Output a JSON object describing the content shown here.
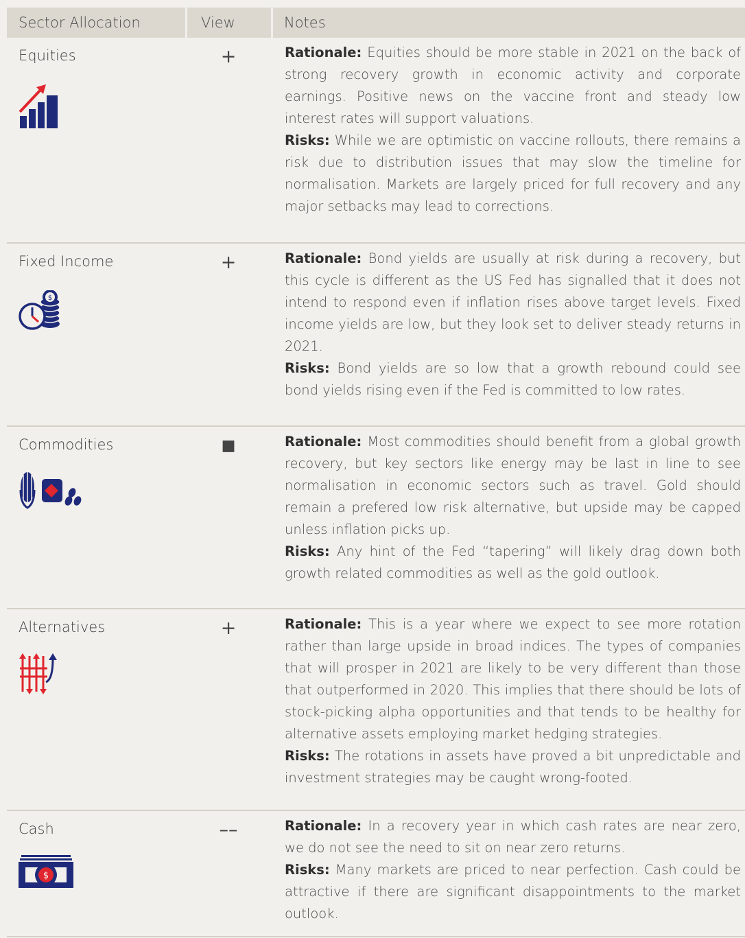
{
  "header": {
    "sector": "Sector Allocation",
    "view": "View",
    "notes": "Notes"
  },
  "rows": [
    {
      "sector": "Equities",
      "icon": "bar-chart-up-arrow-icon",
      "view": "+",
      "rationale_label": "Rationale:",
      "rationale": "Equities should be more stable in 2021 on the back of strong recovery growth in economic activity and corporate earnings. Positive news on the vaccine front and steady low interest rates will support valuations.",
      "risks_label": "Risks:",
      "risks": "While we are optimistic on vaccine rollouts, there remains a risk due to distribution issues that may slow the timeline for normalisation. Markets are largely priced for full recovery and any major setbacks may lead to corrections."
    },
    {
      "sector": "Fixed Income",
      "icon": "clock-coins-icon",
      "view": "+",
      "rationale_label": "Rationale:",
      "rationale": "Bond yields are usually at risk during a recovery, but this cycle is different as the US Fed has signalled that it does not intend to respond even if inflation rises above target levels. Fixed income yields are low, but they look set to deliver steady returns in 2021.",
      "risks_label": "Risks:",
      "risks": "Bond yields are so low that a growth rebound could see bond yields rising even if the Fed is committed to low rates."
    },
    {
      "sector": "Commodities",
      "icon": "corn-sack-beans-icon",
      "view": "■",
      "rationale_label": "Rationale:",
      "rationale": "Most commodities should benefit from a global growth recovery, but key sectors like energy may be last in line to see normalisation in economic sectors such as travel. Gold should remain a prefered low risk alternative, but upside may be capped unless inflation picks up.",
      "risks_label": "Risks:",
      "risks": "Any hint of the Fed “tapering” will likely drag down both growth related commodities as well as the gold outlook."
    },
    {
      "sector": "Alternatives",
      "icon": "up-down-arrows-icon",
      "view": "+",
      "rationale_label": "Rationale:",
      "rationale": "This is a year where we expect to see more rotation rather than large upside in broad indices. The types of companies that will prosper in 2021 are likely to be very different than those that outperformed in 2020. This implies that there should be lots of stock-picking alpha opportunities and that tends to be healthy for alternative assets employing market hedging strategies.",
      "risks_label": "Risks:",
      "risks": "The rotations in assets have proved a bit unpredictable and investment strategies may be caught wrong-footed."
    },
    {
      "sector": "Cash",
      "icon": "banknote-stack-icon",
      "view": "––",
      "rationale_label": "Rationale:",
      "rationale": "In a recovery year in which cash rates are near zero, we do not see the need to sit on near zero returns.",
      "risks_label": "Risks:",
      "risks": "Many markets are priced to near perfection. Cash could be attractive if there are significant disappointments to the market outlook."
    }
  ]
}
